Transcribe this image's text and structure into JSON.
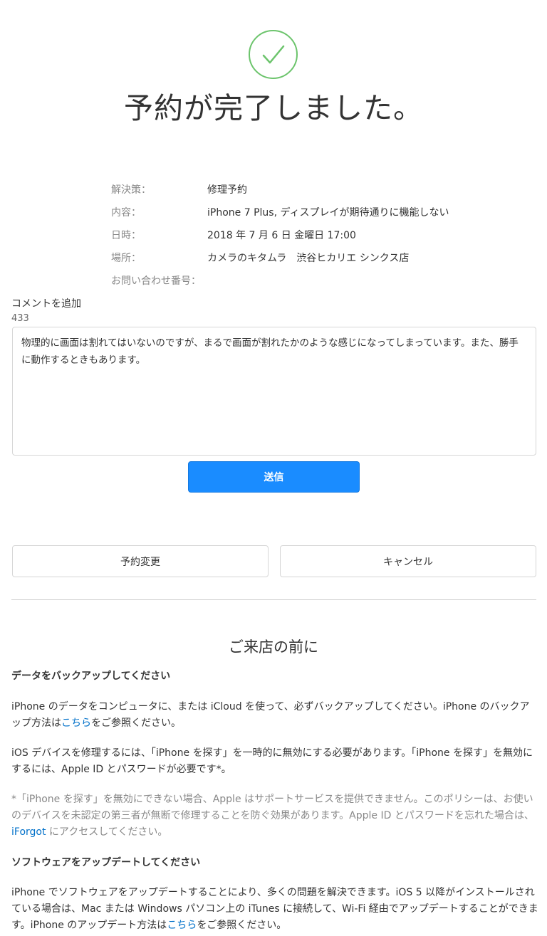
{
  "header": {
    "check_icon": "checkmark-circle-icon",
    "accent_color": "#6cc46c",
    "title": "予約が完了しました。"
  },
  "details": [
    {
      "label": "解決策：",
      "value": "修理予約"
    },
    {
      "label": "内容：",
      "value": "iPhone 7 Plus, ディスプレイが期待通りに機能しない"
    },
    {
      "label": "日時：",
      "value": "2018 年 7 月 6 日 金曜日 17:00"
    },
    {
      "label": "場所：",
      "value": "カメラのキタムラ　渋谷ヒカリエ シンクス店"
    },
    {
      "label": "お問い合わせ番号：",
      "value": ""
    }
  ],
  "comment": {
    "label": "コメントを追加",
    "count": "433",
    "text": "物理的に画面は割れてはいないのですが、まるで画面が割れたかのような感じになってしまっています。また、勝手に動作するときもあります。",
    "submit_label": "送信",
    "submit_color": "#1a8cff"
  },
  "actions": {
    "change_label": "予約変更",
    "cancel_label": "キャンセル"
  },
  "before_visit": {
    "title": "ご来店の前に",
    "backup_heading": "データをバックアップしてください",
    "backup_text": "iPhone のデータをコンピュータに、または iCloud を使って、必ずバックアップしてください。iPhone のバックアップ方法は",
    "backup_link": "こちら",
    "backup_after": "をご参照ください。",
    "findiphone_text": "iOS デバイスを修理するには、「iPhone を探す」を一時的に無効にする必要があります。「iPhone を探す」を無効にするには、Apple ID とパスワードが必要です*。",
    "note_text": "*「iPhone を探す」を無効にできない場合、Apple はサポートサービスを提供できません。このポリシーは、お使いのデバイスを未認定の第三者が無断で修理することを防ぐ効果があります。Apple ID とパスワードを忘れた場合は、",
    "note_link": "iForgot",
    "note_after": " にアクセスしてください。",
    "software_heading": "ソフトウェアをアップデートしてください",
    "software_text": "iPhone でソフトウェアをアップデートすることにより、多くの問題を解決できます。iOS 5 以降がインストールされている場合は、Mac または Windows パソコン上の iTunes に接続して、Wi-Fi 経由でアップデートすることができます。iPhone のアップデート方法は",
    "software_link": "こちら",
    "software_after": "をご参照ください。",
    "link_color": "#0070c9"
  }
}
